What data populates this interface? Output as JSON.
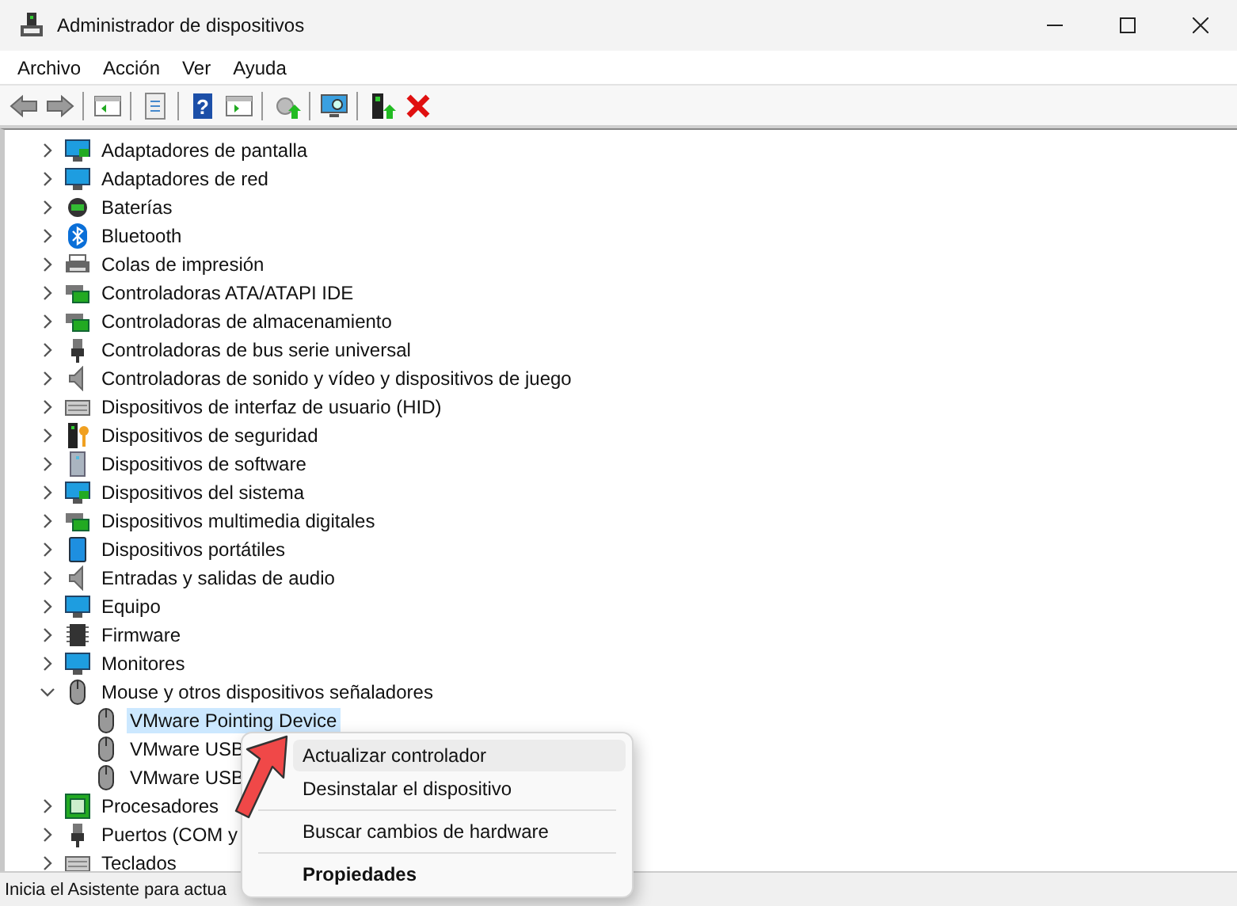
{
  "window": {
    "title": "Administrador de dispositivos"
  },
  "menu_bar": [
    {
      "label": "Archivo"
    },
    {
      "label": "Acción"
    },
    {
      "label": "Ver"
    },
    {
      "label": "Ayuda"
    }
  ],
  "toolbar": [
    {
      "kind": "back"
    },
    {
      "kind": "forward"
    },
    {
      "kind": "separator"
    },
    {
      "kind": "tree"
    },
    {
      "kind": "separator"
    },
    {
      "kind": "properties"
    },
    {
      "kind": "separator"
    },
    {
      "kind": "help",
      "label": "?"
    },
    {
      "kind": "pane"
    },
    {
      "kind": "separator"
    },
    {
      "kind": "update"
    },
    {
      "kind": "separator"
    },
    {
      "kind": "scan"
    },
    {
      "kind": "separator"
    },
    {
      "kind": "enable"
    },
    {
      "kind": "remove"
    }
  ],
  "tree": [
    {
      "label": "Adaptadores de pantalla",
      "kind": "display",
      "expanded": false
    },
    {
      "label": "Adaptadores de red",
      "kind": "network",
      "expanded": false
    },
    {
      "label": "Baterías",
      "kind": "battery",
      "expanded": false
    },
    {
      "label": "Bluetooth",
      "kind": "bluetooth",
      "expanded": false
    },
    {
      "label": "Colas de impresión",
      "kind": "printer",
      "expanded": false
    },
    {
      "label": "Controladoras ATA/ATAPI IDE",
      "kind": "ide",
      "expanded": false
    },
    {
      "label": "Controladoras de almacenamiento",
      "kind": "storage",
      "expanded": false
    },
    {
      "label": "Controladoras de bus serie universal",
      "kind": "usb",
      "expanded": false
    },
    {
      "label": "Controladoras de sonido y vídeo y dispositivos de juego",
      "kind": "sound",
      "expanded": false
    },
    {
      "label": "Dispositivos de interfaz de usuario (HID)",
      "kind": "hid",
      "expanded": false
    },
    {
      "label": "Dispositivos de seguridad",
      "kind": "security",
      "expanded": false
    },
    {
      "label": "Dispositivos de software",
      "kind": "software",
      "expanded": false
    },
    {
      "label": "Dispositivos del sistema",
      "kind": "system",
      "expanded": false
    },
    {
      "label": "Dispositivos multimedia digitales",
      "kind": "multimedia",
      "expanded": false
    },
    {
      "label": "Dispositivos portátiles",
      "kind": "portable",
      "expanded": false
    },
    {
      "label": "Entradas y salidas de audio",
      "kind": "audio",
      "expanded": false
    },
    {
      "label": "Equipo",
      "kind": "computer",
      "expanded": false
    },
    {
      "label": "Firmware",
      "kind": "firmware",
      "expanded": false
    },
    {
      "label": "Monitores",
      "kind": "monitor",
      "expanded": false
    },
    {
      "label": "Mouse y otros dispositivos señaladores",
      "kind": "mouse",
      "expanded": true,
      "children": [
        {
          "label": "VMware Pointing Device",
          "selected": true
        },
        {
          "label": "VMware USB",
          "selected": false
        },
        {
          "label": "VMware USB",
          "selected": false
        }
      ]
    },
    {
      "label": "Procesadores",
      "kind": "cpu",
      "expanded": false
    },
    {
      "label": "Puertos (COM y",
      "kind": "port",
      "expanded": false
    },
    {
      "label": "Teclados",
      "kind": "keyboard",
      "expanded": false
    }
  ],
  "context_menu": [
    {
      "kind": "item",
      "label": "Actualizar controlador",
      "highlighted": true
    },
    {
      "kind": "item",
      "label": "Desinstalar el dispositivo",
      "highlighted": false
    },
    {
      "kind": "separator"
    },
    {
      "kind": "item",
      "label": "Buscar cambios de hardware",
      "highlighted": false
    },
    {
      "kind": "separator"
    },
    {
      "kind": "default",
      "label": "Propiedades",
      "highlighted": false
    }
  ],
  "status_bar": {
    "text": "Inicia el Asistente para actua"
  }
}
